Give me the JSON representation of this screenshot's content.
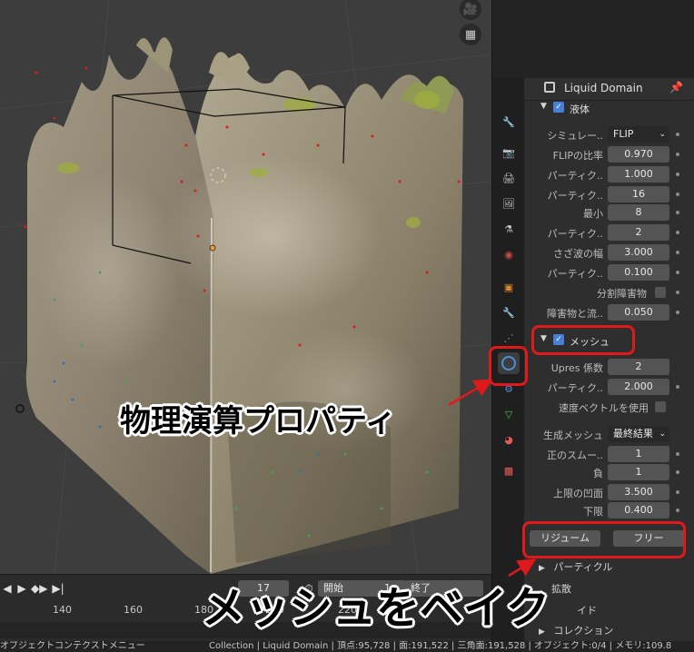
{
  "viewport": {
    "timeline_frame": "17",
    "start_label": "開始",
    "start_value": "1",
    "end_label": "終了",
    "ruler_ticks": [
      "140",
      "160",
      "180",
      "200",
      "220"
    ]
  },
  "properties": {
    "header_title": "Liquid Domain",
    "liquid_section": "液体",
    "rows_liquid": [
      {
        "label": "シミュレー..",
        "value": "FLIP"
      },
      {
        "label": "FLIPの比率",
        "value": "0.970"
      },
      {
        "label": "パーティク..",
        "value": "1.000"
      },
      {
        "label": "パーティク..",
        "value": "16"
      },
      {
        "label": "最小",
        "value": "8"
      },
      {
        "label": "パーティク..",
        "value": "2"
      },
      {
        "label": "さざ波の幅",
        "value": "3.000"
      },
      {
        "label": "パーティク..",
        "value": "0.100"
      }
    ],
    "split_obstacle": "分割障害物",
    "obstacle_row": {
      "label": "障害物と流..",
      "value": "0.050"
    },
    "mesh_section": "メッシュ",
    "rows_mesh": [
      {
        "label": "Upres 係数",
        "value": "2"
      },
      {
        "label": "パーティク..",
        "value": "2.000"
      }
    ],
    "use_velocity": "速度ベクトルを使用",
    "gen_mesh": {
      "label": "生成メッシュ",
      "value": "最終結果"
    },
    "rows_smooth": [
      {
        "label": "正のスムー..",
        "value": "1"
      },
      {
        "label": "負",
        "value": "1"
      },
      {
        "label": "上限の凹面",
        "value": "3.500"
      },
      {
        "label": "下限",
        "value": "0.400"
      }
    ],
    "resume_button": "リジューム",
    "free_button": "フリー",
    "sub_particle": "パーティクル",
    "sub_diffuse": "拡散",
    "sub_guide": "イド",
    "sub_collection": "コレクション"
  },
  "status": {
    "left": "オブジェクトコンテクストメニュー",
    "right": "Collection | Liquid Domain | 頂点:95,728 | 面:191,522 | 三角面:191,528 | オブジェクト:0/4 | メモリ:109.8"
  },
  "annotations": {
    "physics_label": "物理演算プロパティ",
    "bake_label": "メッシュをベイク"
  },
  "colors": {
    "accent": "#4a7fd6",
    "annotation_red": "#e0191b"
  }
}
